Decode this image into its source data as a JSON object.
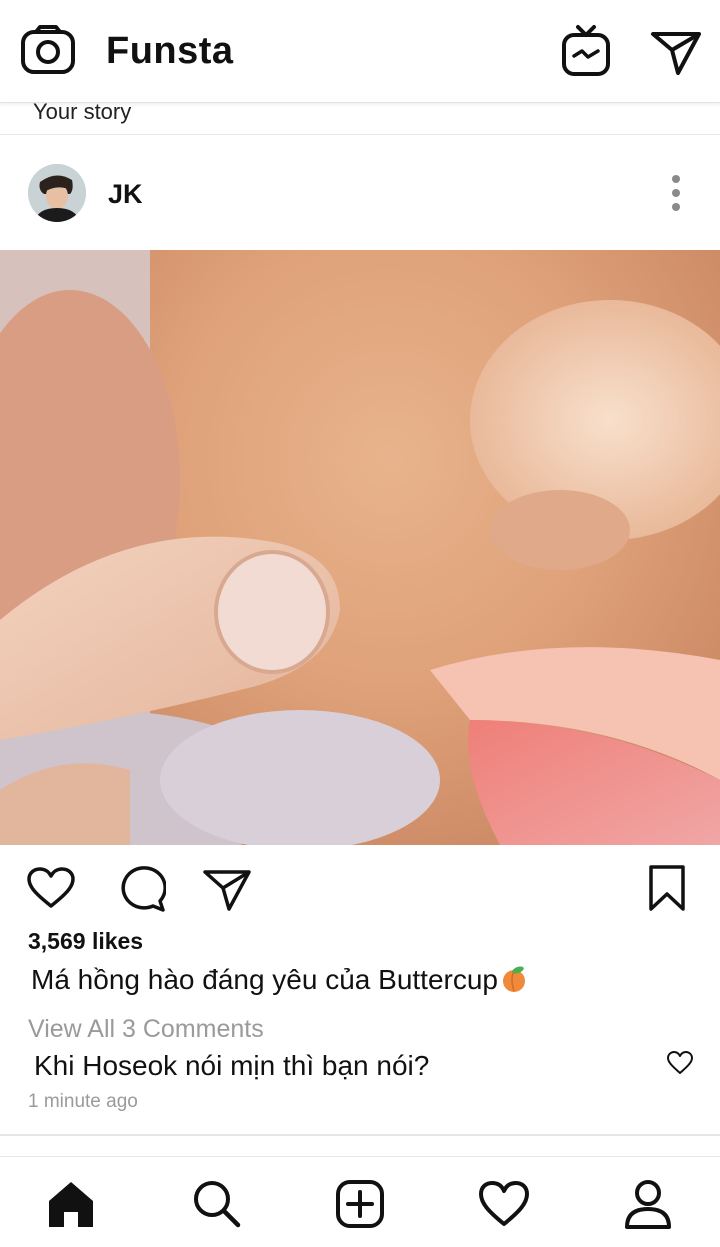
{
  "app": {
    "name": "Funsta",
    "top_icons": [
      "camera-icon",
      "igtv-icon",
      "direct-send-icon"
    ]
  },
  "stories": {
    "label": "Your story"
  },
  "post": {
    "username": "JK",
    "avatar": "profile-photo",
    "likes": "3,569 likes",
    "caption": "Má hồng hào đáng yêu của Buttercup",
    "caption_emoji": "peach-emoji",
    "view_comments": "View All 3 Comments",
    "comment": "Khi Hoseok nói mịn thì bạn nói?",
    "timestamp": "1 minute ago",
    "action_icons": [
      "heart-icon",
      "comment-icon",
      "share-icon",
      "bookmark-icon"
    ]
  },
  "bottom_nav": [
    "home-icon",
    "search-icon",
    "add-post-icon",
    "activity-heart-icon",
    "profile-icon"
  ],
  "colors": {
    "background": "#ffffff",
    "text": "#111111",
    "muted": "#9a9a9a",
    "divider": "#e6e6e6"
  }
}
